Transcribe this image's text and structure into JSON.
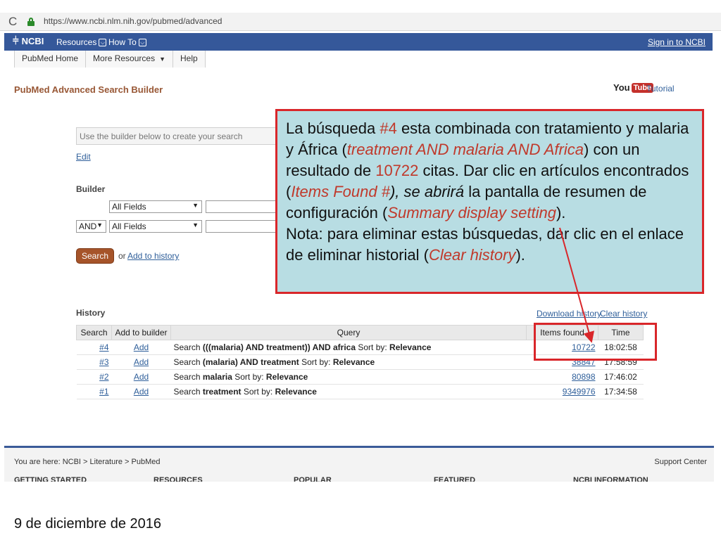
{
  "browser": {
    "url": "https://www.ncbi.nlm.nih.gov/pubmed/advanced",
    "refresh_glyph": "C"
  },
  "ncbi_bar": {
    "logo": "NCBI",
    "resources": "Resources",
    "howto": "How To",
    "signin": "Sign in to NCBI"
  },
  "subnav": {
    "home": "PubMed Home",
    "more": "More Resources",
    "help": "Help"
  },
  "page": {
    "title": "PubMed Advanced Search Builder",
    "youtube_you": "You",
    "youtube_tube": "Tube",
    "tutorial": "Tutorial"
  },
  "builder": {
    "query_placeholder": "Use the builder below to create your search",
    "edit": "Edit",
    "heading": "Builder",
    "row1_field": "All Fields",
    "row2_op": "AND",
    "row2_field": "All Fields",
    "search_button": "Search",
    "or": "or",
    "add_to_history": "Add to history"
  },
  "history": {
    "heading": "History",
    "download": "Download history",
    "clear": "Clear history",
    "columns": [
      "Search",
      "Add to builder",
      "Query",
      "Items found",
      "Time"
    ],
    "rows": [
      {
        "num": "#4",
        "add": "Add",
        "prefix": "Search ",
        "query": "(((malaria) AND treatment)) AND africa",
        "sortlabel": " Sort by: ",
        "sort": "Relevance",
        "items": "10722",
        "time": "18:02:58"
      },
      {
        "num": "#3",
        "add": "Add",
        "prefix": "Search ",
        "query": "(malaria) AND treatment",
        "sortlabel": " Sort by: ",
        "sort": "Relevance",
        "items": "38847",
        "time": "17:58:59"
      },
      {
        "num": "#2",
        "add": "Add",
        "prefix": "Search ",
        "query": "malaria",
        "sortlabel": " Sort by: ",
        "sort": "Relevance",
        "items": "80898",
        "time": "17:46:02"
      },
      {
        "num": "#1",
        "add": "Add",
        "prefix": "Search ",
        "query": "treatment",
        "sortlabel": " Sort by: ",
        "sort": "Relevance",
        "items": "9349976",
        "time": "17:34:58"
      }
    ]
  },
  "callout": {
    "p1": "La búsqueda ",
    "p2": "#4",
    "p3": " esta combinada con  tratamiento y malaria y África (",
    "p4": "treatment AND malaria AND Africa",
    "p5": ") con un resultado de ",
    "p6": "10722",
    "p7": " citas. Dar clic en artículos encontrados (",
    "p8": "Items Found #",
    "p9": "), se abrirá",
    "p10": " la pantalla de resumen de configuración (",
    "p11": "Summary display setting",
    "p12": ").",
    "p13": "Nota: para eliminar estas búsquedas, dar clic en el enlace de eliminar historial (",
    "p14": "Clear history",
    "p15": ")."
  },
  "footer": {
    "breadcrumb": "You are here: NCBI > Literature > PubMed",
    "support": "Support Center",
    "cols": [
      "GETTING STARTED",
      "RESOURCES",
      "POPULAR",
      "FEATURED",
      "NCBI INFORMATION"
    ]
  },
  "slide_date": "9 de diciembre de 2016",
  "colors": {
    "ncbi_blue": "#35589a",
    "title_brown": "#985735",
    "callout_bg": "#b8dde3",
    "annotation_red": "#d9262a",
    "link_blue": "#2f5f9a"
  }
}
